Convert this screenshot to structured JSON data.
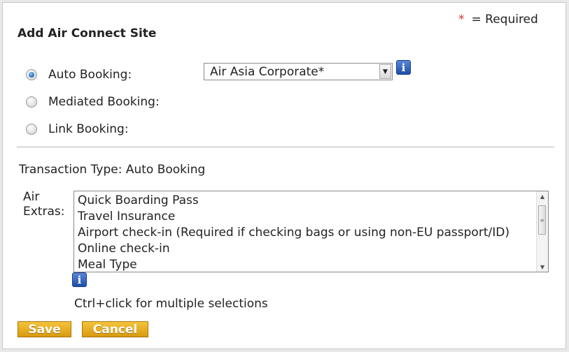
{
  "required_note": {
    "star": "*",
    "text": "= Required"
  },
  "title": "Add Air Connect Site",
  "booking_options": [
    {
      "label": "Auto Booking:",
      "checked": true
    },
    {
      "label": "Mediated Booking:",
      "checked": false
    },
    {
      "label": "Link Booking:",
      "checked": false
    }
  ],
  "site_select": {
    "value": "Air Asia Corporate*"
  },
  "transaction_type": "Transaction Type: Auto Booking",
  "extras": {
    "label_line1": "Air",
    "label_line2": "Extras:",
    "items": [
      "Quick Boarding Pass",
      "Travel Insurance",
      "Airport check-in (Required if checking bags or using non-EU passport/ID)",
      "Online check-in",
      "Meal Type"
    ]
  },
  "hint": "Ctrl+click for multiple selections",
  "buttons": {
    "save": "Save",
    "cancel": "Cancel"
  },
  "icons": {
    "info": "info-icon",
    "dropdown": "chevron-down-icon"
  },
  "colors": {
    "accent_button": "#e8b022",
    "info_icon": "#2a5bb5",
    "required_star": "#d93030"
  }
}
